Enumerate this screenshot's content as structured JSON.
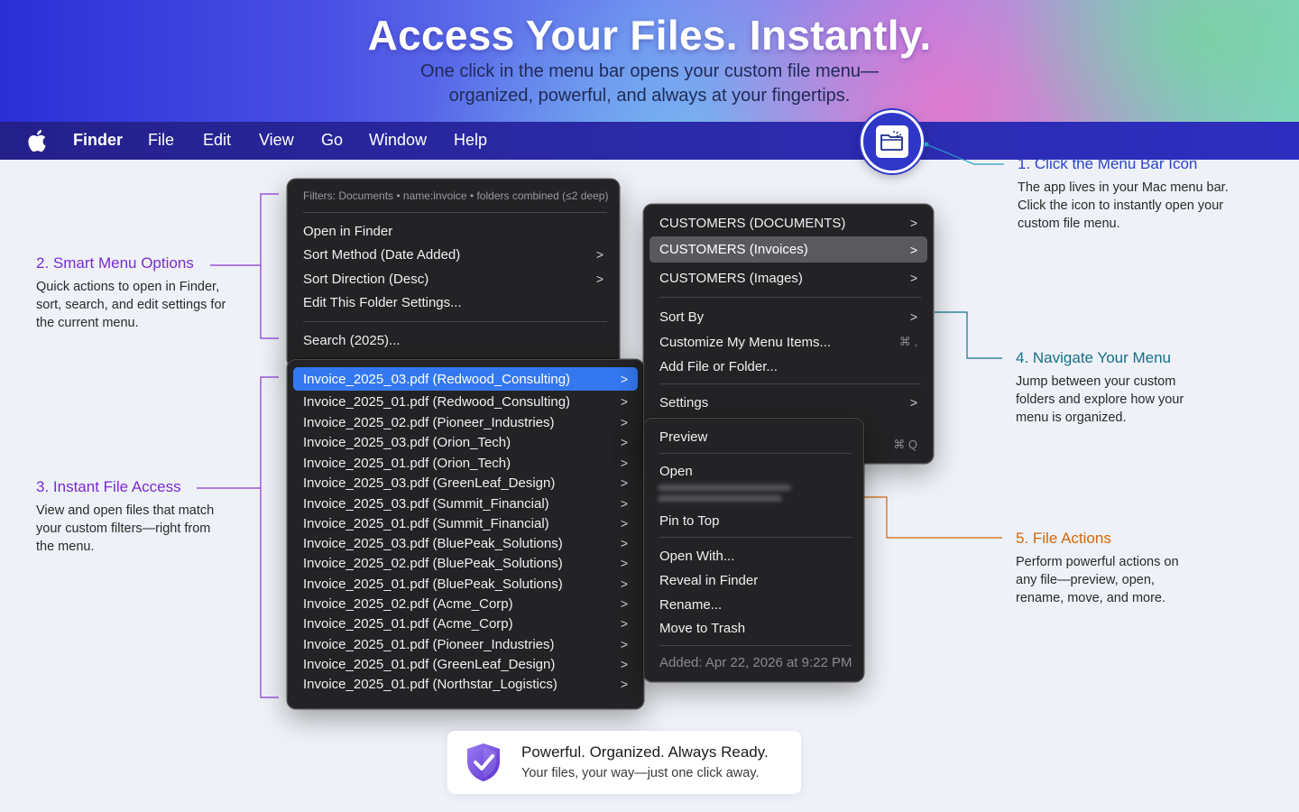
{
  "hero": {
    "title": "Access Your Files. Instantly.",
    "subtitle": "One click in the menu bar opens your custom file menu—organized, powerful, and always at your fingertips."
  },
  "menubar": {
    "items": [
      "Finder",
      "File",
      "Edit",
      "View",
      "Go",
      "Window",
      "Help"
    ],
    "app_icon": "folder-sparkle-icon"
  },
  "callouts": {
    "step1": {
      "title": "1. Click the Menu Bar Icon",
      "desc": "The app lives in your Mac menu bar. Click the icon to instantly open your custom file menu."
    },
    "step2": {
      "title": "2. Smart Menu Options",
      "desc": "Quick actions to open in Finder, sort, search, and edit settings for the current menu."
    },
    "step3": {
      "title": "3. Instant File Access",
      "desc": "View and open files that match your custom filters—right from the menu."
    },
    "step4": {
      "title": "4. Navigate Your Menu",
      "desc": "Jump between your custom folders and explore how your menu is organized."
    },
    "step5": {
      "title": "5. File Actions",
      "desc": "Perform powerful actions on any file—preview, open, rename, move, and more."
    }
  },
  "main_menu": {
    "filter": "Filters: Documents • name:invoice • folders combined (≤2 deep)",
    "options": [
      {
        "label": "Open in Finder",
        "submenu": false
      },
      {
        "label": "Sort Method (Date Added)",
        "submenu": true
      },
      {
        "label": "Sort Direction (Desc)",
        "submenu": true
      },
      {
        "label": "Edit This Folder Settings...",
        "submenu": false
      }
    ],
    "search": "Search (2025)..."
  },
  "files": [
    "Invoice_2025_03.pdf (Redwood_Consulting)",
    "Invoice_2025_01.pdf (Redwood_Consulting)",
    "Invoice_2025_02.pdf (Pioneer_Industries)",
    "Invoice_2025_03.pdf (Orion_Tech)",
    "Invoice_2025_01.pdf (Orion_Tech)",
    "Invoice_2025_03.pdf (GreenLeaf_Design)",
    "Invoice_2025_03.pdf (Summit_Financial)",
    "Invoice_2025_01.pdf (Summit_Financial)",
    "Invoice_2025_03.pdf (BluePeak_Solutions)",
    "Invoice_2025_02.pdf (BluePeak_Solutions)",
    "Invoice_2025_01.pdf (BluePeak_Solutions)",
    "Invoice_2025_02.pdf (Acme_Corp)",
    "Invoice_2025_01.pdf (Acme_Corp)",
    "Invoice_2025_01.pdf (Pioneer_Industries)",
    "Invoice_2025_01.pdf (GreenLeaf_Design)",
    "Invoice_2025_01.pdf (Northstar_Logistics)"
  ],
  "nav_menu": {
    "folders": [
      "CUSTOMERS (DOCUMENTS)",
      "CUSTOMERS (Invoices)",
      "CUSTOMERS (Images)"
    ],
    "sort_by": "Sort By",
    "customize": "Customize My Menu Items...",
    "customize_shortcut": "⌘ ,",
    "add": "Add File or Folder...",
    "settings": "Settings",
    "quit_shortcut": "⌘ Q"
  },
  "actions_menu": {
    "preview": "Preview",
    "open": "Open",
    "pin": "Pin to Top",
    "open_with": "Open With...",
    "reveal": "Reveal in Finder",
    "rename": "Rename...",
    "trash": "Move to Trash",
    "added": "Added: Apr 22, 2026 at 9:22 PM"
  },
  "footer": {
    "title": "Powerful. Organized. Always Ready.",
    "subtitle": "Your files, your way—just one click away."
  },
  "colors": {
    "menubar": "#2b2aa8",
    "highlight": "#3478f0",
    "step1": "#2a45c8",
    "step2": "#7a2bd0",
    "step4": "#15708a",
    "step5": "#d2680a"
  }
}
